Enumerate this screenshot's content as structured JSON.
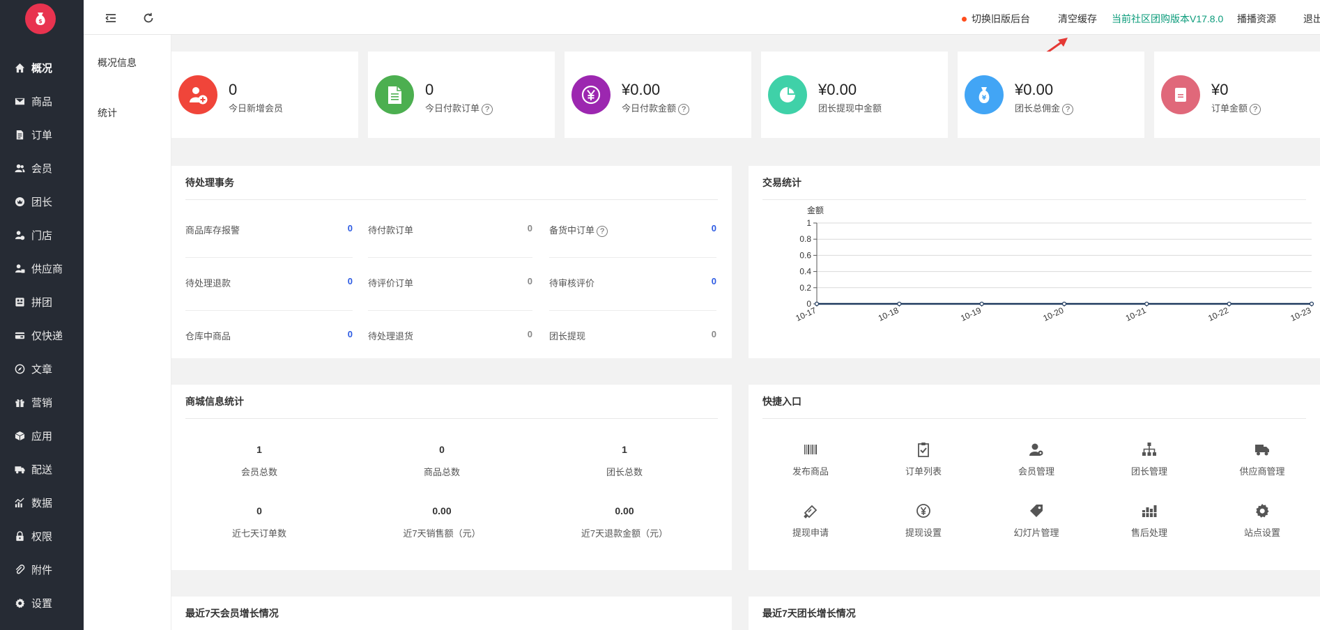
{
  "sidebar": {
    "items": [
      {
        "label": "概况",
        "icon": "home-icon",
        "active": true
      },
      {
        "label": "商品",
        "icon": "mail-icon"
      },
      {
        "label": "订单",
        "icon": "document-icon"
      },
      {
        "label": "会员",
        "icon": "users-icon"
      },
      {
        "label": "团长",
        "icon": "crown-icon"
      },
      {
        "label": "门店",
        "icon": "store-user-icon"
      },
      {
        "label": "供应商",
        "icon": "supplier-icon"
      },
      {
        "label": "拼团",
        "icon": "group-buy-icon"
      },
      {
        "label": "仅快递",
        "icon": "express-icon"
      },
      {
        "label": "文章",
        "icon": "compass-icon"
      },
      {
        "label": "营销",
        "icon": "gift-icon"
      },
      {
        "label": "应用",
        "icon": "cube-icon"
      },
      {
        "label": "配送",
        "icon": "truck-icon"
      },
      {
        "label": "数据",
        "icon": "chart-icon"
      },
      {
        "label": "权限",
        "icon": "lock-icon"
      },
      {
        "label": "附件",
        "icon": "paperclip-icon"
      },
      {
        "label": "设置",
        "icon": "gear-icon"
      }
    ]
  },
  "subnav": {
    "items": [
      {
        "label": "概况信息"
      },
      {
        "label": "统计"
      }
    ]
  },
  "topbar": {
    "switch_old": "切换旧版后台",
    "clear_cache": "清空缓存",
    "version": "当前社区团购版本V17.8.0",
    "broadcast": "播播资源",
    "logout": "退出"
  },
  "stats": [
    {
      "value": "0",
      "label": "今日新增会员",
      "help": false,
      "color": "#f0453a",
      "icon": "add-user-icon"
    },
    {
      "value": "0",
      "label": "今日付款订单",
      "help": true,
      "color": "#4caf50",
      "icon": "document-icon"
    },
    {
      "value": "¥0.00",
      "label": "今日付款金额",
      "help": true,
      "color": "#9c27b0",
      "icon": "yen-icon"
    },
    {
      "value": "¥0.00",
      "label": "团长提现中金额",
      "help": false,
      "color": "#3fd1a8",
      "icon": "pie-icon"
    },
    {
      "value": "¥0.00",
      "label": "团长总佣金",
      "help": true,
      "color": "#42a5f5",
      "icon": "money-bag-icon"
    },
    {
      "value": "¥0",
      "label": "订单金额",
      "help": true,
      "color": "#e0687a",
      "icon": "note-icon"
    }
  ],
  "help_mark": "?",
  "pending": {
    "title": "待处理事务",
    "items": [
      {
        "label": "商品库存报警",
        "value": "0",
        "blue": true,
        "help": false
      },
      {
        "label": "待付款订单",
        "value": "0",
        "blue": false,
        "help": false
      },
      {
        "label": "备货中订单",
        "value": "0",
        "blue": true,
        "help": true
      },
      {
        "label": "待处理退款",
        "value": "0",
        "blue": true,
        "help": false
      },
      {
        "label": "待评价订单",
        "value": "0",
        "blue": false,
        "help": false
      },
      {
        "label": "待审核评价",
        "value": "0",
        "blue": true,
        "help": false
      },
      {
        "label": "仓库中商品",
        "value": "0",
        "blue": true,
        "help": false
      },
      {
        "label": "待处理退货",
        "value": "0",
        "blue": false,
        "help": false
      },
      {
        "label": "团长提现",
        "value": "0",
        "blue": false,
        "help": false
      }
    ]
  },
  "trade": {
    "title": "交易统计"
  },
  "chart_data": {
    "type": "line",
    "title": "",
    "ylabel": "金额",
    "xlabel": "",
    "categories": [
      "10-17",
      "10-18",
      "10-19",
      "10-20",
      "10-21",
      "10-22",
      "10-23"
    ],
    "series": [
      {
        "values": [
          0,
          0,
          0,
          0,
          0,
          0,
          0
        ]
      }
    ],
    "ylim": [
      0,
      1
    ],
    "yticks": [
      "0",
      "0.2",
      "0.4",
      "0.6",
      "0.8",
      "1"
    ],
    "grid": true,
    "line_color": "#1f3a5f"
  },
  "mall": {
    "title": "商城信息统计",
    "items": [
      {
        "value": "1",
        "label": "会员总数"
      },
      {
        "value": "0",
        "label": "商品总数"
      },
      {
        "value": "1",
        "label": "团长总数"
      },
      {
        "value": "0",
        "label": "近七天订单数"
      },
      {
        "value": "0.00",
        "label": "近7天销售额（元）"
      },
      {
        "value": "0.00",
        "label": "近7天退款金额（元）"
      }
    ]
  },
  "quick": {
    "title": "快捷入口",
    "items": [
      {
        "label": "发布商品",
        "icon": "barcode-icon"
      },
      {
        "label": "订单列表",
        "icon": "clipboard-check-icon"
      },
      {
        "label": "会员管理",
        "icon": "user-manage-icon"
      },
      {
        "label": "团长管理",
        "icon": "org-chart-icon"
      },
      {
        "label": "供应商管理",
        "icon": "truck-icon"
      },
      {
        "label": "提现申请",
        "icon": "ticket-icon"
      },
      {
        "label": "提现设置",
        "icon": "yen-circle-icon"
      },
      {
        "label": "幻灯片管理",
        "icon": "tag-icon"
      },
      {
        "label": "售后处理",
        "icon": "bars-icon"
      },
      {
        "label": "站点设置",
        "icon": "gear-icon"
      }
    ]
  },
  "bottom": {
    "left_title": "最近7天会员增长情况",
    "right_title": "最近7天团长增长情况"
  }
}
